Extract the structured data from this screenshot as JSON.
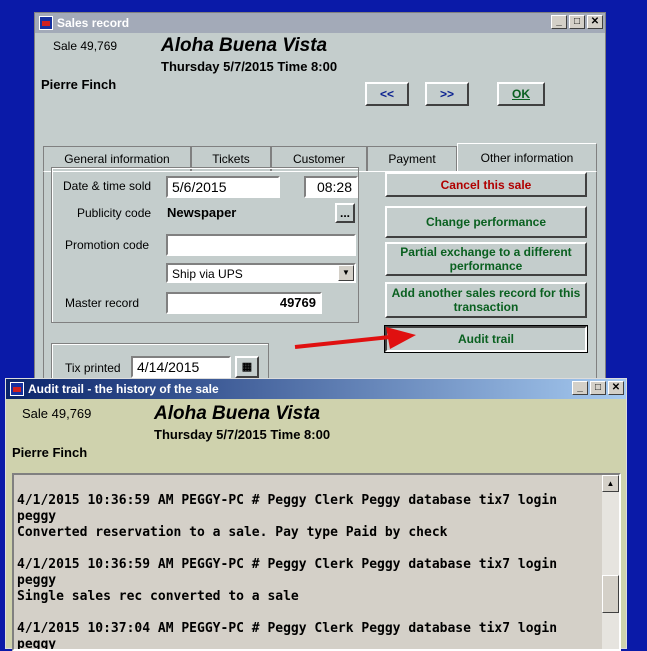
{
  "sales_window": {
    "title": "Sales record",
    "sale_number": "Sale 49,769",
    "show_title": "Aloha Buena Vista",
    "date_line": "Thursday 5/7/2015  Time 8:00",
    "customer": "Pierre Finch",
    "nav_prev": "<<",
    "nav_next": ">>",
    "ok": "OK",
    "tabs": [
      {
        "label": "General information"
      },
      {
        "label": "Tickets"
      },
      {
        "label": "Customer"
      },
      {
        "label": "Payment"
      },
      {
        "label": "Other information"
      }
    ],
    "fields": {
      "date_time_sold_label": "Date & time sold",
      "date_sold": "5/6/2015",
      "time_sold": "08:28",
      "publicity_code_label": "Publicity code",
      "publicity_code": "Newspaper",
      "ellipsis": "...",
      "promotion_code_label": "Promotion code",
      "promotion_code": "",
      "shipping": "Ship via UPS",
      "master_record_label": "Master record",
      "master_record": "49769",
      "tix_printed_label": "Tix printed",
      "tix_printed": "4/14/2015"
    },
    "actions": {
      "cancel": "Cancel this sale",
      "change_performance": "Change performance",
      "partial_exchange": "Partial exchange to a different performance",
      "add_another": "Add another sales record for this transaction",
      "audit_trail": "Audit trail"
    }
  },
  "audit_window": {
    "title": "Audit trail - the history of the sale",
    "sale_number": "Sale 49,769",
    "show_title": "Aloha Buena Vista",
    "date_line": "Thursday 5/7/2015  Time 8:00",
    "customer": "Pierre Finch",
    "entries": [
      {
        "header": "4/1/2015 10:36:59 AM PEGGY-PC # Peggy Clerk Peggy database tix7 login peggy",
        "detail": "Converted reservation to a sale. Pay type Paid by check"
      },
      {
        "header": "4/1/2015 10:36:59 AM PEGGY-PC # Peggy Clerk Peggy database tix7 login peggy",
        "detail": "Single sales rec converted to a sale"
      },
      {
        "header": "4/1/2015 10:37:04 AM PEGGY-PC # Peggy Clerk Peggy database tix7 login peggy",
        "detail": ""
      }
    ]
  },
  "colors": {
    "desktop": "#0a1aa8",
    "cancel_text": "#b00000",
    "arrow": "#e01010",
    "audit_header_bg": "#cfd2ad"
  },
  "icons": {
    "minimize": "minimize-icon",
    "maximize": "maximize-icon",
    "close": "close-icon",
    "calendar": "calendar-icon",
    "dropdown": "chevron-down-icon"
  }
}
